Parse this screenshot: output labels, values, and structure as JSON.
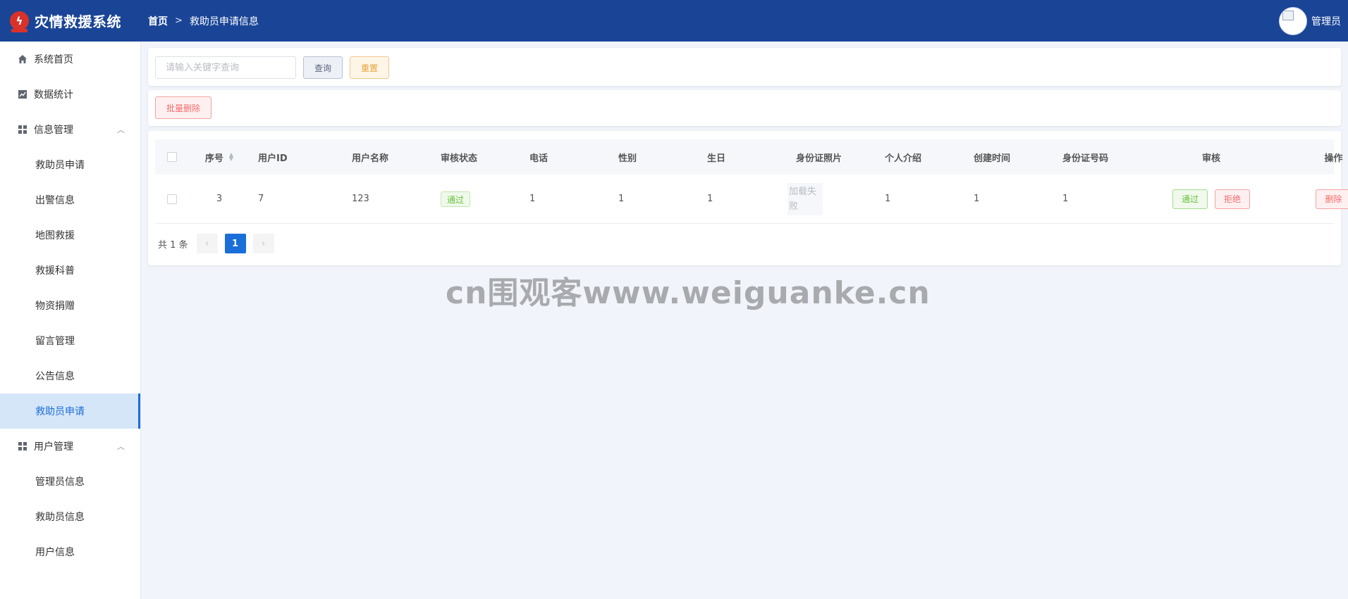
{
  "app": {
    "title": "灾情救援系统"
  },
  "breadcrumb": {
    "home": "首页",
    "separator": ">",
    "current": "救助员申请信息"
  },
  "user": {
    "name": "管理员"
  },
  "sidebar": {
    "items": [
      {
        "label": "系统首页",
        "icon": "home-icon"
      },
      {
        "label": "数据统计",
        "icon": "chart-icon"
      },
      {
        "label": "信息管理",
        "icon": "grid-icon",
        "expanded": true
      },
      {
        "label": "救助员申请"
      },
      {
        "label": "出警信息"
      },
      {
        "label": "地图救援"
      },
      {
        "label": "救援科普"
      },
      {
        "label": "物资捐赠"
      },
      {
        "label": "留言管理"
      },
      {
        "label": "公告信息"
      },
      {
        "label": "救助员申请",
        "active": true
      },
      {
        "label": "用户管理",
        "icon": "grid-icon",
        "expanded": true
      },
      {
        "label": "管理员信息"
      },
      {
        "label": "救助员信息"
      },
      {
        "label": "用户信息"
      }
    ]
  },
  "search": {
    "placeholder": "请输入关键字查询",
    "value": "",
    "query_label": "查询",
    "reset_label": "重置"
  },
  "actions": {
    "batch_delete_label": "批量删除"
  },
  "table": {
    "columns": [
      "序号",
      "用户ID",
      "用户名称",
      "审核状态",
      "电话",
      "性别",
      "生日",
      "身份证照片",
      "个人介绍",
      "创建时间",
      "身份证号码",
      "审核",
      "操作"
    ],
    "rows": [
      {
        "seq": "3",
        "user_id": "7",
        "user_name": "123",
        "status": "通过",
        "phone": "1",
        "gender": "1",
        "birthday": "1",
        "id_photo": "加载失败",
        "intro": "1",
        "created": "1",
        "id_number": "1",
        "approve_label": "通过",
        "reject_label": "拒绝",
        "delete_label": "删除"
      }
    ]
  },
  "pagination": {
    "total_text": "共 1 条",
    "current_page": "1",
    "prev": "‹",
    "next": "›"
  },
  "watermark": "cn围观客www.weiguanke.cn",
  "colors": {
    "header_bg": "#1a4597",
    "accent": "#1a6ed8",
    "active_menu_bg": "#d6e6f9",
    "logo_red": "#d9322b"
  }
}
